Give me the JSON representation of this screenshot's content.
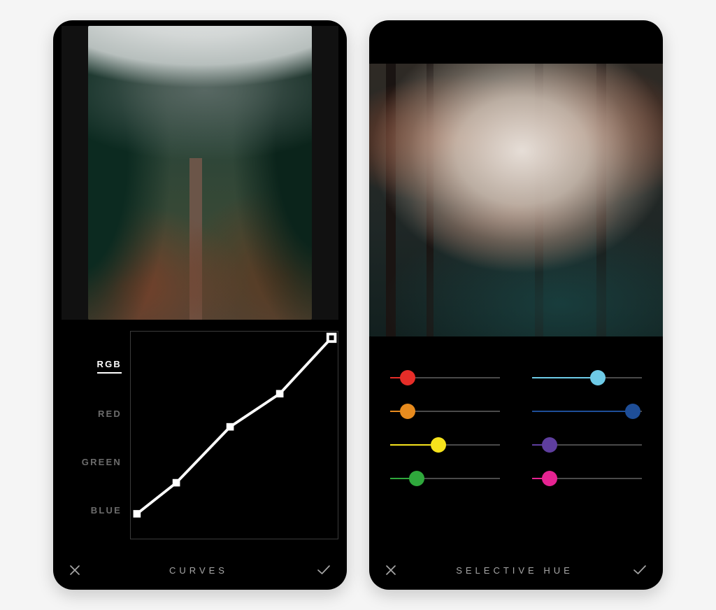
{
  "screens": {
    "curves": {
      "title": "CURVES",
      "channels": [
        {
          "id": "rgb",
          "label": "RGB",
          "active": true
        },
        {
          "id": "red",
          "label": "RED",
          "active": false
        },
        {
          "id": "green",
          "label": "GREEN",
          "active": false
        },
        {
          "id": "blue",
          "label": "BLUE",
          "active": false
        }
      ],
      "curve_points": [
        {
          "x": 0.03,
          "y": 0.88
        },
        {
          "x": 0.22,
          "y": 0.73
        },
        {
          "x": 0.48,
          "y": 0.46
        },
        {
          "x": 0.72,
          "y": 0.3
        },
        {
          "x": 0.97,
          "y": 0.03
        }
      ]
    },
    "selective_hue": {
      "title": "SELECTIVE HUE",
      "sliders": [
        {
          "id": "red",
          "color": "#E62D28",
          "value": 0.16
        },
        {
          "id": "cyan",
          "color": "#6ECBE7",
          "value": 0.6
        },
        {
          "id": "orange",
          "color": "#E78B1E",
          "value": 0.16
        },
        {
          "id": "blue",
          "color": "#1E4E98",
          "value": 0.92
        },
        {
          "id": "yellow",
          "color": "#F6E31C",
          "value": 0.44
        },
        {
          "id": "purple",
          "color": "#5E3E9E",
          "value": 0.16
        },
        {
          "id": "green",
          "color": "#2FA83C",
          "value": 0.24
        },
        {
          "id": "magenta",
          "color": "#E62392",
          "value": 0.16
        }
      ]
    }
  },
  "icons": {
    "close": "close-icon",
    "confirm": "check-icon"
  }
}
